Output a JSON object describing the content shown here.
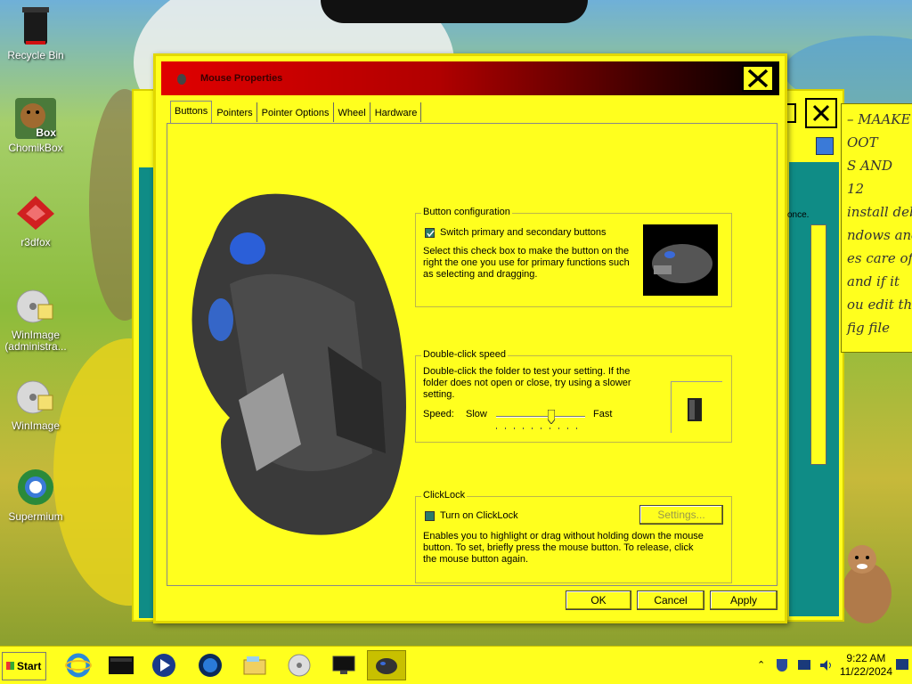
{
  "desktop": {
    "icons": [
      {
        "label": "Recycle Bin",
        "icon": "recycle-bin-icon"
      },
      {
        "label": "ChomikBox",
        "icon": "chomikbox-icon",
        "badge": "Box"
      },
      {
        "label": "r3dfox",
        "icon": "r3dfox-icon"
      },
      {
        "label": "WinImage (administra...",
        "icon": "winimage-admin-icon"
      },
      {
        "label": "WinImage",
        "icon": "winimage-icon"
      },
      {
        "label": "Supermium",
        "icon": "supermium-icon"
      }
    ]
  },
  "background_window": {
    "note_lines": [
      "– MAAKE",
      "OOT",
      "S AND",
      "12",
      "install deb",
      "ndows and",
      "es care of",
      "and if it",
      "ou edit the",
      "fig file"
    ],
    "partial_label": "once."
  },
  "dialog": {
    "title": "Mouse Properties",
    "tabs": [
      {
        "label": "Buttons",
        "active": true
      },
      {
        "label": "Pointers",
        "active": false
      },
      {
        "label": "Pointer Options",
        "active": false
      },
      {
        "label": "Wheel",
        "active": false
      },
      {
        "label": "Hardware",
        "active": false
      }
    ],
    "button_config": {
      "legend": "Button configuration",
      "checkbox_label": "Switch primary and secondary buttons",
      "checked": true,
      "description": "Select this check box to make the button on the right the one you use for primary functions such as selecting and dragging."
    },
    "double_click": {
      "legend": "Double-click speed",
      "description": "Double-click the folder to test your setting. If the folder does not open or close, try using a slower setting.",
      "speed_label": "Speed:",
      "slow_label": "Slow",
      "fast_label": "Fast",
      "speed_value": 0.6
    },
    "clicklock": {
      "legend": "ClickLock",
      "checkbox_label": "Turn on ClickLock",
      "checked": false,
      "settings_button": "Settings...",
      "description": "Enables you to highlight or drag without holding down the mouse button. To set, briefly press the mouse button. To release, click the mouse button again."
    },
    "buttons": {
      "ok": "OK",
      "cancel": "Cancel",
      "apply": "Apply"
    }
  },
  "taskbar": {
    "start_label": "Start",
    "time": "9:22 AM",
    "date": "11/22/2024",
    "items": [
      "internet-explorer-icon",
      "terminal-icon",
      "media-player-icon",
      "globe-icon",
      "folder-icon",
      "disc-icon",
      "monitor-icon",
      "mouse-icon"
    ]
  },
  "colors": {
    "accent": "#ffff1e",
    "title_red": "#e00000",
    "teal": "#0f8c86"
  }
}
